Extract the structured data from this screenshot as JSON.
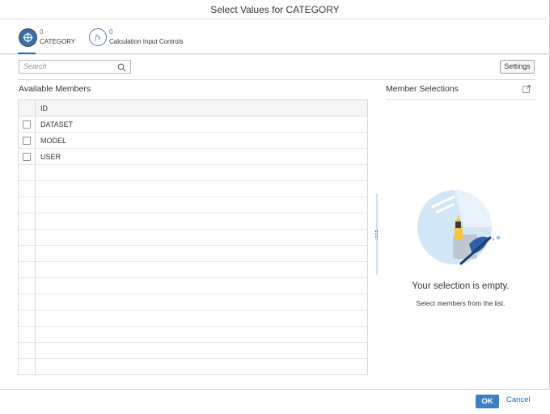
{
  "dialog": {
    "title": "Select Values for CATEGORY"
  },
  "tabs": [
    {
      "count": "0",
      "label": "CATEGORY",
      "icon": "member-filter-icon"
    },
    {
      "count": "0",
      "label": "Calculation Input Controls",
      "icon": "fx-icon"
    }
  ],
  "toolbar": {
    "search_placeholder": "Search",
    "settings_label": "Settings"
  },
  "available": {
    "title": "Available Members",
    "column_header": "ID",
    "rows": [
      "DATASET",
      "MODEL",
      "USER"
    ]
  },
  "selections": {
    "title": "Member Selections",
    "empty_title": "Your selection is empty.",
    "empty_subtitle": "Select members from the list."
  },
  "footer": {
    "ok_label": "OK",
    "cancel_label": "Cancel"
  },
  "colors": {
    "accent": "#0a6ed1",
    "ok_button": "#3d7fc4",
    "active_tab_icon": "#3a6ea5"
  }
}
